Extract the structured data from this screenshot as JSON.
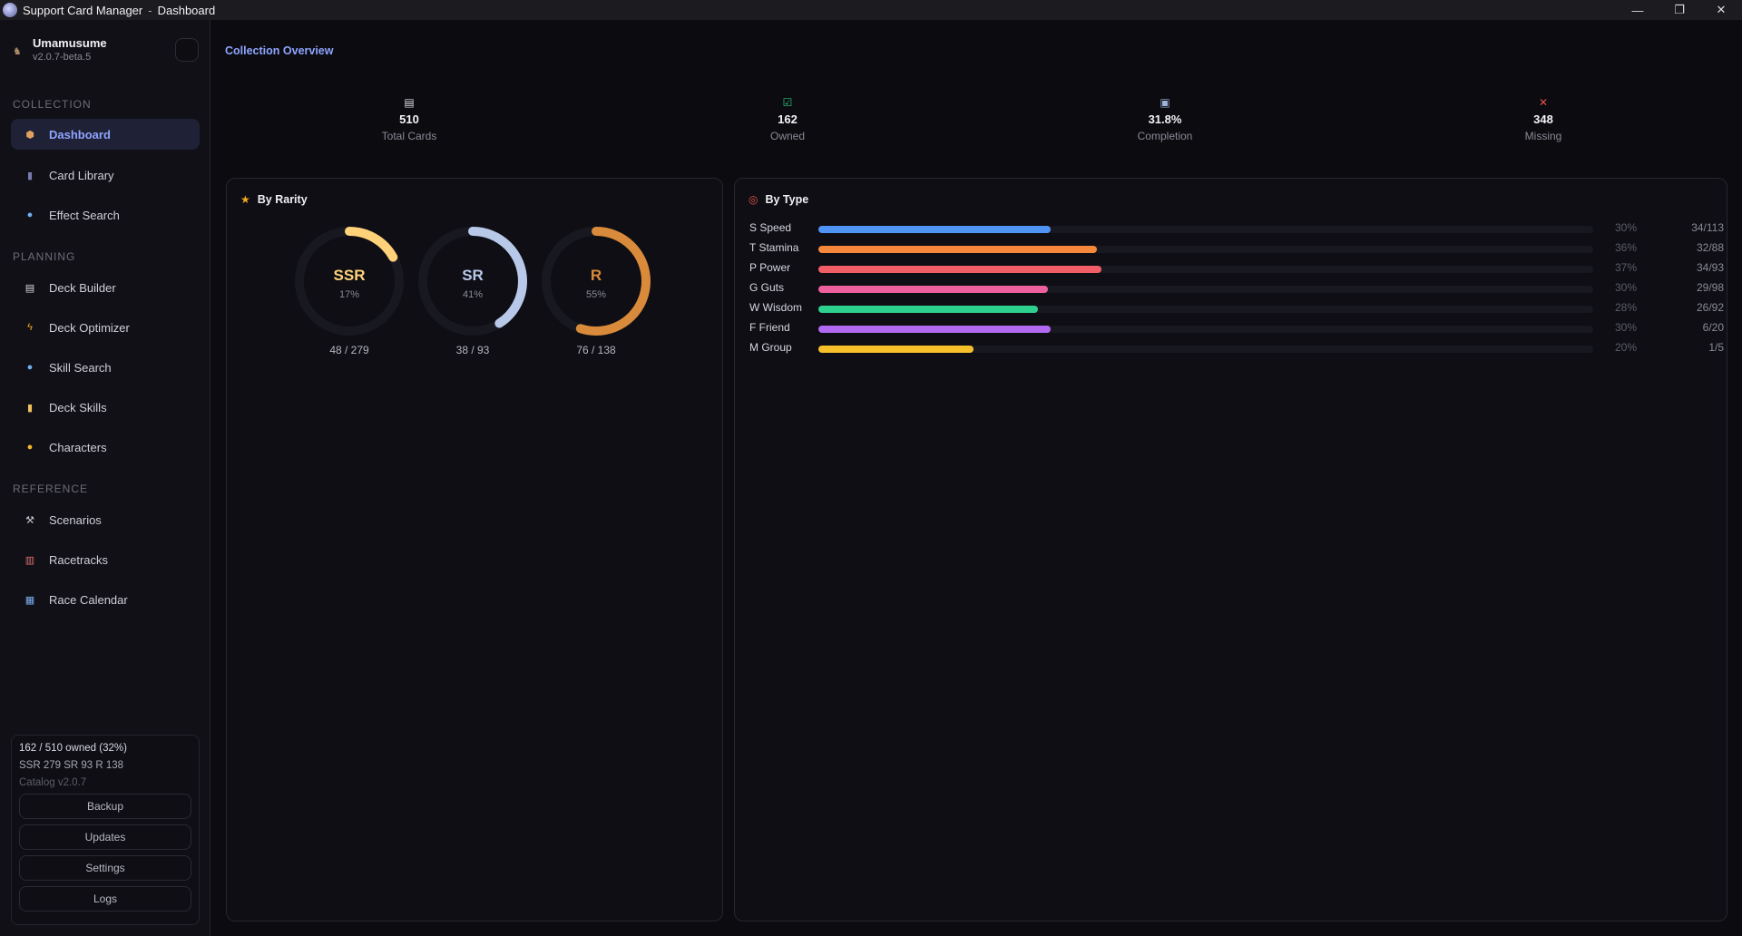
{
  "window": {
    "app_name": "Support Card Manager",
    "separator": "-",
    "page": "Dashboard",
    "controls": [
      "—",
      "❐",
      "✕"
    ]
  },
  "brand": {
    "name": "Umamusume",
    "version": "v2.0.7-beta.5"
  },
  "sidebar": {
    "sections": [
      {
        "label": "COLLECTION",
        "items": [
          {
            "label": "Dashboard",
            "icon": "cube-icon",
            "active": true
          },
          {
            "label": "Card Library",
            "icon": "book-icon"
          },
          {
            "label": "Effect Search",
            "icon": "magnifier-icon"
          }
        ]
      },
      {
        "label": "PLANNING",
        "items": [
          {
            "label": "Deck Builder",
            "icon": "clipboard-icon"
          },
          {
            "label": "Deck Optimizer",
            "icon": "lightning-icon"
          },
          {
            "label": "Skill Search",
            "icon": "search-icon"
          },
          {
            "label": "Deck Skills",
            "icon": "scroll-icon"
          },
          {
            "label": "Characters",
            "icon": "face-icon"
          }
        ]
      },
      {
        "label": "REFERENCE",
        "items": [
          {
            "label": "Scenarios",
            "icon": "hammer-icon"
          },
          {
            "label": "Racetracks",
            "icon": "stadium-icon"
          },
          {
            "label": "Race Calendar",
            "icon": "calendar-icon"
          }
        ]
      }
    ],
    "footer": {
      "owned_summary": "162 / 510 owned  (32%)",
      "rarity_summary": "SSR 279  SR 93  R 138",
      "catalog": "Catalog v2.0.7",
      "buttons": [
        "Backup",
        "Updates",
        "Settings",
        "Logs"
      ]
    }
  },
  "main": {
    "title": "Collection Overview",
    "stats": [
      {
        "value": "510",
        "label": "Total Cards",
        "icon": "document-icon",
        "color": "#d9d9e0"
      },
      {
        "value": "162",
        "label": "Owned",
        "icon": "check-icon",
        "color": "#2ec27e"
      },
      {
        "value": "31.8%",
        "label": "Completion",
        "icon": "chart-icon",
        "color": "#9fb3d9"
      },
      {
        "value": "348",
        "label": "Missing",
        "icon": "cross-icon",
        "color": "#e5534b"
      }
    ],
    "rarity_panel": {
      "title": "By Rarity",
      "icon": "star-icon",
      "items": [
        {
          "name": "SSR",
          "pct_label": "17%",
          "fraction": 0.17,
          "count": "48 / 279",
          "color": "#ffd27a"
        },
        {
          "name": "SR",
          "pct_label": "41%",
          "fraction": 0.41,
          "count": "38 / 93",
          "color": "#b8c8e8"
        },
        {
          "name": "R",
          "pct_label": "55%",
          "fraction": 0.55,
          "count": "76 / 138",
          "color": "#d98a3a"
        }
      ]
    },
    "type_panel": {
      "title": "By Type",
      "icon": "target-icon",
      "rows": [
        {
          "label": "S  Speed",
          "fraction": 0.3,
          "pct": "30%",
          "count": "34/113",
          "color": "#4f94f5"
        },
        {
          "label": "T  Stamina",
          "fraction": 0.36,
          "pct": "36%",
          "count": "32/88",
          "color": "#f5883a"
        },
        {
          "label": "P  Power",
          "fraction": 0.365,
          "pct": "37%",
          "count": "34/93",
          "color": "#f25e66"
        },
        {
          "label": "G  Guts",
          "fraction": 0.296,
          "pct": "30%",
          "count": "29/98",
          "color": "#ee5f9e"
        },
        {
          "label": "W  Wisdom",
          "fraction": 0.283,
          "pct": "28%",
          "count": "26/92",
          "color": "#2ed08d"
        },
        {
          "label": "F  Friend",
          "fraction": 0.3,
          "pct": "30%",
          "count": "6/20",
          "color": "#b069f0"
        },
        {
          "label": "M  Group",
          "fraction": 0.2,
          "pct": "20%",
          "count": "1/5",
          "color": "#f7c02b"
        }
      ]
    }
  }
}
